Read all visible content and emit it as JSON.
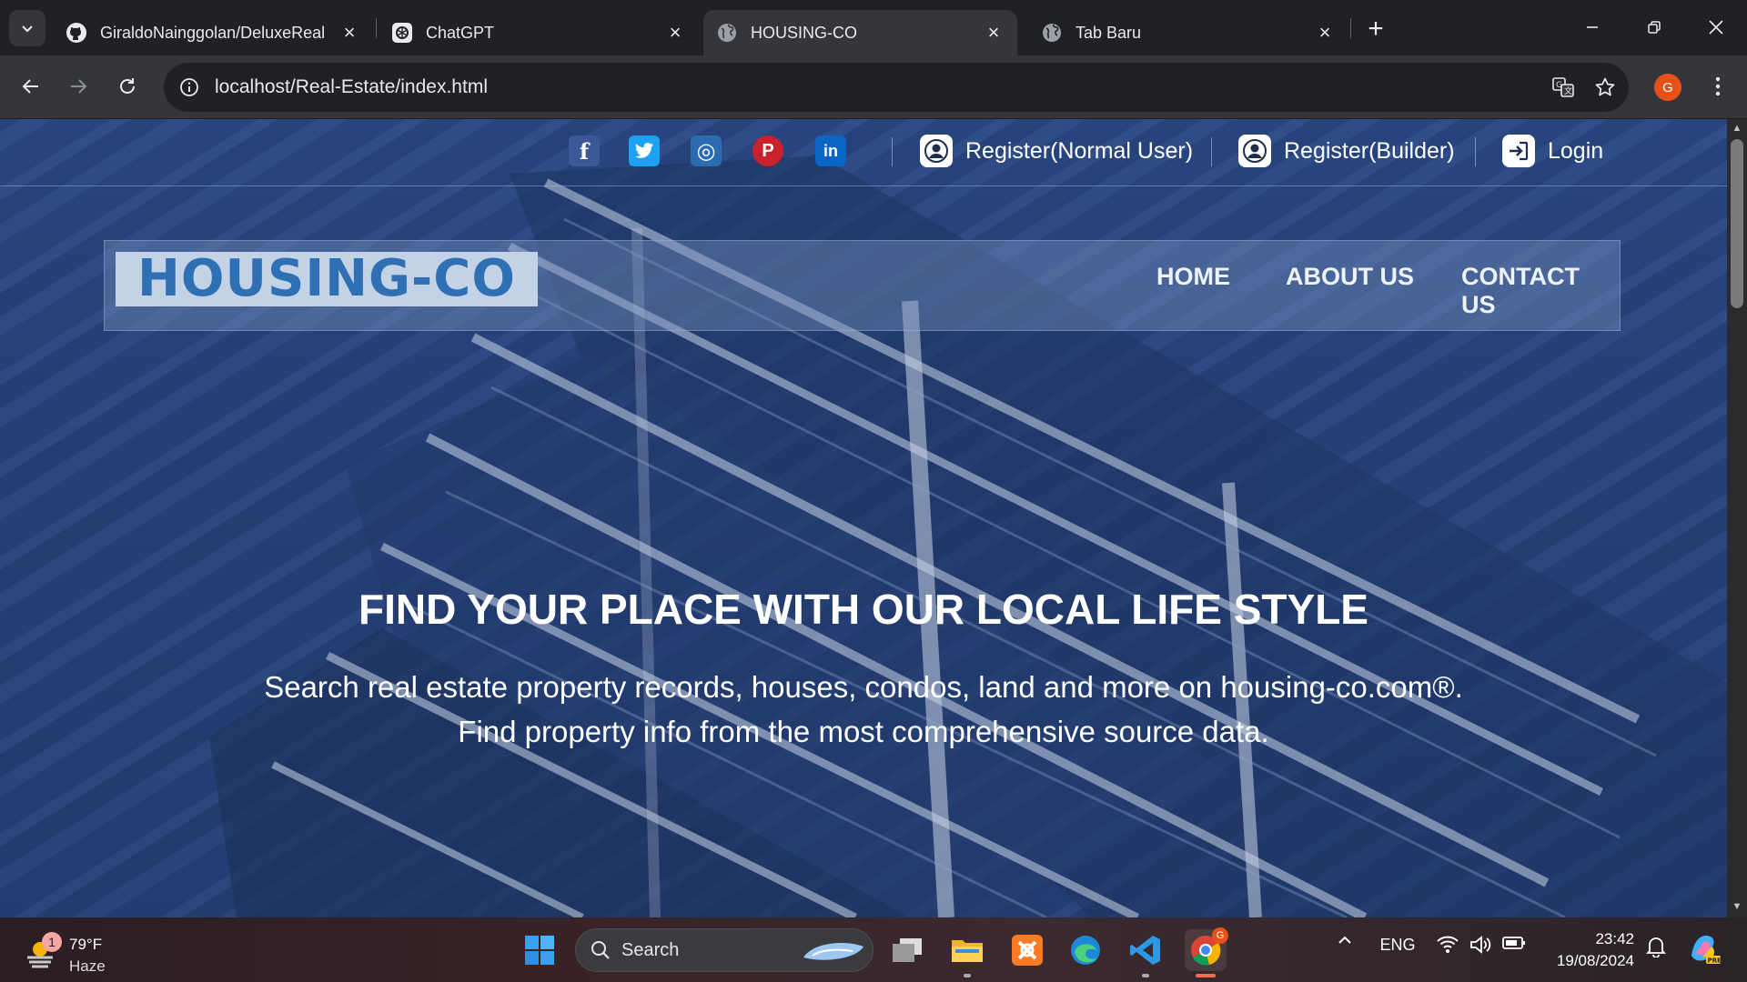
{
  "browser": {
    "tabs": [
      {
        "title": "GiraldoNainggolan/DeluxeReal",
        "favicon": "github-icon"
      },
      {
        "title": "ChatGPT",
        "favicon": "chatgpt-icon"
      },
      {
        "title": "HOUSING-CO",
        "favicon": "globe-icon",
        "active": true
      },
      {
        "title": "Tab Baru",
        "favicon": "globe-icon"
      }
    ],
    "url": "localhost/Real-Estate/index.html",
    "profile_initial": "G"
  },
  "site": {
    "topbar": {
      "socials": [
        "facebook-icon",
        "twitter-icon",
        "instagram-icon",
        "pinterest-icon",
        "linkedin-icon"
      ],
      "social_glyphs": {
        "facebook": "f",
        "instagram": "◎",
        "pinterest": "P",
        "linkedin": "in"
      },
      "register_user": "Register(Normal User)",
      "register_builder": "Register(Builder)",
      "login": "Login"
    },
    "logo_text": "HOUSING-CO",
    "nav": {
      "home": "HOME",
      "about": "ABOUT US",
      "contact": "CONTACT US"
    },
    "hero": {
      "title": "FIND YOUR PLACE WITH OUR LOCAL LIFE STYLE",
      "line1": "Search real estate property records, houses, condos, land and more on housing-co.com®.",
      "line2": "Find property info from the most comprehensive source data."
    }
  },
  "taskbar": {
    "weather_temp": "79°F",
    "weather_cond": "Haze",
    "weather_badge": "1",
    "search_label": "Search",
    "lang": "ENG",
    "time": "23:42",
    "date": "19/08/2024",
    "chrome_badge": "G"
  },
  "colors": {
    "chrome_bg": "#202124",
    "chrome_toolbar": "#35363a",
    "logo_blue": "#2f6fb3",
    "facebook": "#3b5998",
    "twitter": "#1da1f2",
    "instagram": "#2b6cb0",
    "pinterest": "#c8232c",
    "linkedin": "#0a66c2"
  }
}
